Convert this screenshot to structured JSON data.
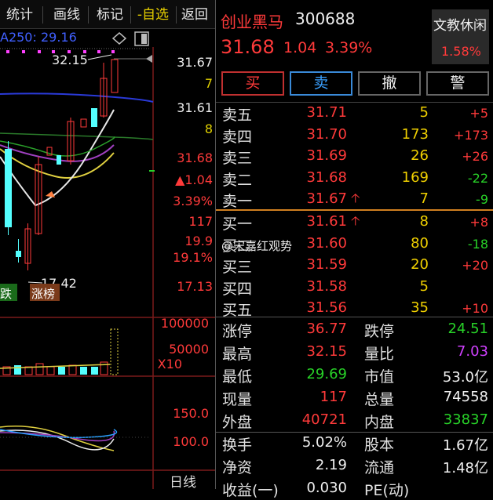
{
  "toolbar": {
    "items": [
      "统计",
      "画线",
      "标记",
      "-自选",
      "返回"
    ]
  },
  "chart": {
    "ma_label": "A250: 29.16",
    "high_marker": "32.15",
    "low_marker": "17.42",
    "price_axis": [
      "31.67",
      "7",
      "31.61",
      "8",
      "31.68",
      "▲1.04",
      "3.39%",
      "117",
      "19.9",
      "19.1%",
      "17.13"
    ],
    "badge_fall": "跌",
    "badge_rise": "涨榜",
    "volume_axis": [
      "100000",
      "50000",
      "X10"
    ],
    "indicator_axis": [
      "150.0",
      "100.0"
    ],
    "period_label": "日线"
  },
  "stock": {
    "name": "创业黑马",
    "code": "300688",
    "price": "31.68",
    "change": "1.04",
    "change_pct": "3.39%",
    "sector": "文教休闲",
    "sector_pct": "1.58%"
  },
  "trade_buttons": {
    "buy": "买",
    "sell": "卖",
    "cancel": "撤",
    "alert": "警"
  },
  "order_book": {
    "asks": [
      {
        "label": "卖五",
        "price": "31.71",
        "vol": "5",
        "delta": "+5"
      },
      {
        "label": "卖四",
        "price": "31.70",
        "vol": "173",
        "delta": "+173"
      },
      {
        "label": "卖三",
        "price": "31.69",
        "vol": "26",
        "delta": "+26"
      },
      {
        "label": "卖二",
        "price": "31.68",
        "vol": "169",
        "delta": "-22"
      },
      {
        "label": "卖一",
        "price": "31.67",
        "vol": "7",
        "delta": "-9"
      }
    ],
    "bids": [
      {
        "label": "买一",
        "price": "31.61",
        "vol": "8",
        "delta": "+8"
      },
      {
        "label": "买二",
        "price": "31.60",
        "vol": "80",
        "delta": "-18"
      },
      {
        "label": "买三",
        "price": "31.59",
        "vol": "20",
        "delta": "+20"
      },
      {
        "label": "买四",
        "price": "31.58",
        "vol": "5",
        "delta": ""
      },
      {
        "label": "买五",
        "price": "31.56",
        "vol": "35",
        "delta": "+10"
      }
    ]
  },
  "watermark": "@宋嘉红观势",
  "stats_top": [
    {
      "l1": "涨停",
      "v1": "36.77",
      "l2": "跌停",
      "v2": "24.51"
    },
    {
      "l1": "最高",
      "v1": "32.15",
      "l2": "量比",
      "v2": "7.03"
    },
    {
      "l1": "最低",
      "v1": "29.69",
      "l2": "市值",
      "v2": "53.0亿"
    },
    {
      "l1": "现量",
      "v1": "117",
      "l2": "总量",
      "v2": "74558"
    },
    {
      "l1": "外盘",
      "v1": "40721",
      "l2": "内盘",
      "v2": "33837"
    }
  ],
  "stats_bottom": [
    {
      "l1": "换手",
      "v1": "5.02%",
      "l2": "股本",
      "v2": "1.67亿"
    },
    {
      "l1": "净资",
      "v1": "2.19",
      "l2": "流通",
      "v2": "1.48亿"
    },
    {
      "l1": "收益(一)",
      "v1": "0.030",
      "l2": "PE(动)",
      "v2": ""
    }
  ],
  "colors": {
    "up": "#ff3a3a",
    "down": "#28d228",
    "cyan_candle": "#54ffff",
    "accent_yellow": "#f0d000"
  }
}
